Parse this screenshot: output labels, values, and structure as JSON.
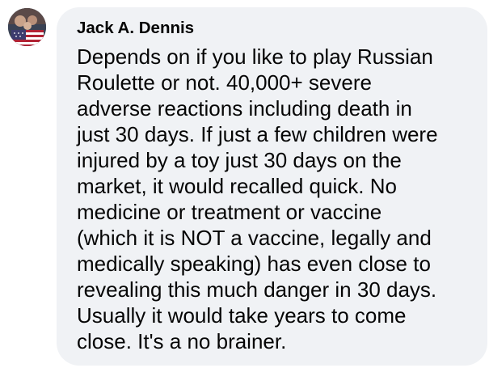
{
  "comment": {
    "author": "Jack A. Dennis",
    "avatar_icon": "profile-photo-american-flag",
    "text_lines": [
      "Depends on if you like to play Russian",
      "Roulette or not. 40,000+ severe",
      "adverse reactions including death in",
      "just 30 days. If just a few children were",
      "injured by a toy just 30 days on the",
      "market, it would recalled quick. No",
      "medicine or treatment or vaccine",
      "(which it is NOT a vaccine, legally and",
      "medically speaking) has even close to",
      "revealing this much danger in 30 days.",
      "Usually it would take years to come",
      "close. It's a no brainer."
    ]
  },
  "colors": {
    "bubble_background": "#f0f2f5",
    "text": "#050505"
  }
}
